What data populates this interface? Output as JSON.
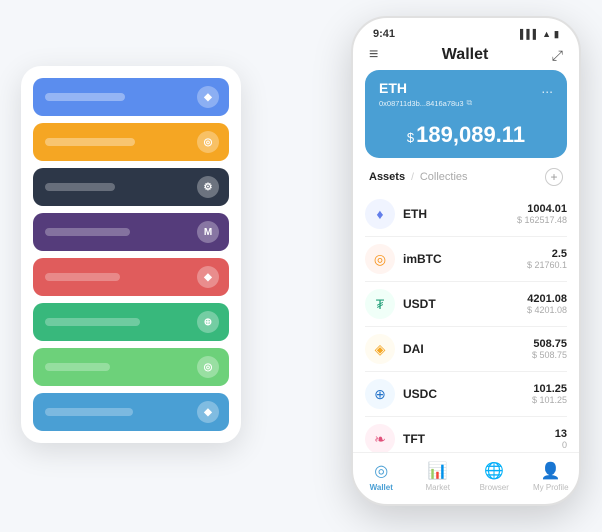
{
  "scene": {
    "cards": [
      {
        "color": "blue",
        "lineWidth": 80
      },
      {
        "color": "orange",
        "lineWidth": 90
      },
      {
        "color": "dark",
        "lineWidth": 70
      },
      {
        "color": "purple",
        "lineWidth": 85
      },
      {
        "color": "red",
        "lineWidth": 75
      },
      {
        "color": "green",
        "lineWidth": 95
      },
      {
        "color": "lightgreen",
        "lineWidth": 65
      },
      {
        "color": "blue2",
        "lineWidth": 88
      }
    ]
  },
  "phone": {
    "statusBar": {
      "time": "9:41",
      "signal": "▌▌▌",
      "wifi": "▲",
      "battery": "▮"
    },
    "header": {
      "menuIcon": "≡",
      "title": "Wallet",
      "expandIcon": "⤢"
    },
    "walletCard": {
      "coinName": "ETH",
      "address": "0x08711d3b...8416a78u3",
      "copyIcon": "⧉",
      "dotsMenu": "...",
      "currencySymbol": "$",
      "amount": "189,089.11"
    },
    "assetsTabs": {
      "active": "Assets",
      "separator": "/",
      "inactive": "Collecties",
      "addIcon": "+"
    },
    "assets": [
      {
        "name": "ETH",
        "icon": "♦",
        "iconClass": "eth-icon",
        "amountPrimary": "1004.01",
        "amountSecondary": "$ 162517.48"
      },
      {
        "name": "imBTC",
        "icon": "◎",
        "iconClass": "imbtc-icon",
        "amountPrimary": "2.5",
        "amountSecondary": "$ 21760.1"
      },
      {
        "name": "USDT",
        "icon": "₮",
        "iconClass": "usdt-icon",
        "amountPrimary": "4201.08",
        "amountSecondary": "$ 4201.08"
      },
      {
        "name": "DAI",
        "icon": "◈",
        "iconClass": "dai-icon",
        "amountPrimary": "508.75",
        "amountSecondary": "$ 508.75"
      },
      {
        "name": "USDC",
        "icon": "⊕",
        "iconClass": "usdc-icon",
        "amountPrimary": "101.25",
        "amountSecondary": "$ 101.25"
      },
      {
        "name": "TFT",
        "icon": "❧",
        "iconClass": "tft-icon",
        "amountPrimary": "13",
        "amountSecondary": "0"
      }
    ],
    "bottomNav": [
      {
        "icon": "◎",
        "label": "Wallet",
        "active": true
      },
      {
        "icon": "📊",
        "label": "Market",
        "active": false
      },
      {
        "icon": "🌐",
        "label": "Browser",
        "active": false
      },
      {
        "icon": "👤",
        "label": "My Profile",
        "active": false
      }
    ]
  }
}
